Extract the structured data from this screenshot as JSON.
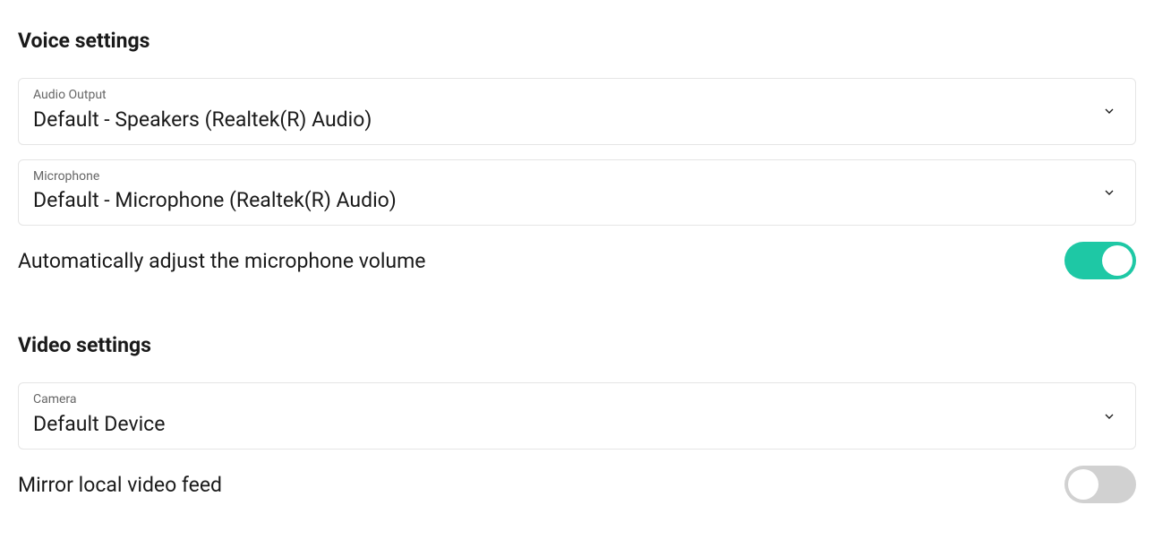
{
  "voice": {
    "title": "Voice settings",
    "audio_output": {
      "label": "Audio Output",
      "value": "Default - Speakers (Realtek(R) Audio)"
    },
    "microphone": {
      "label": "Microphone",
      "value": "Default - Microphone (Realtek(R) Audio)"
    },
    "auto_adjust": {
      "label": "Automatically adjust the microphone volume",
      "enabled": true
    }
  },
  "video": {
    "title": "Video settings",
    "camera": {
      "label": "Camera",
      "value": "Default Device"
    },
    "mirror": {
      "label": "Mirror local video feed",
      "enabled": false
    }
  }
}
